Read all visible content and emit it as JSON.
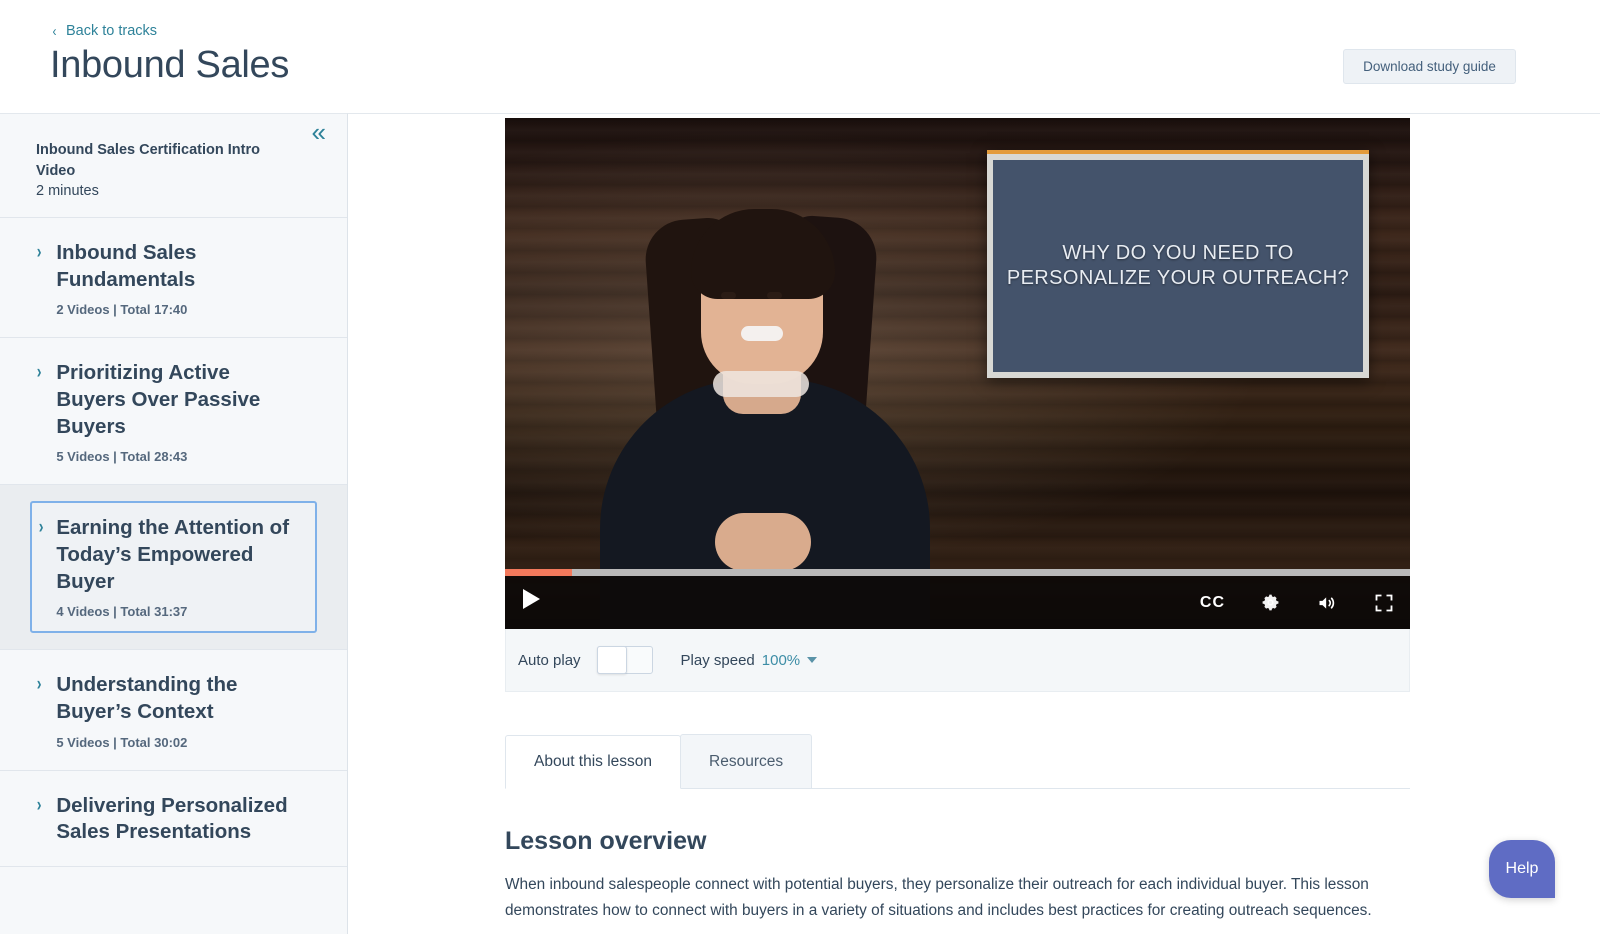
{
  "header": {
    "back_link": "Back to tracks",
    "back_icon": "chevron-left-icon",
    "title": "Inbound Sales",
    "download_button": "Download study guide"
  },
  "sidebar": {
    "collapse_icon": "«",
    "intro": {
      "title": "Inbound Sales Certification Intro Video",
      "duration": "2 minutes"
    },
    "modules": [
      {
        "chevron": "›",
        "title": "Inbound Sales Fundamentals",
        "meta": "2 Videos | Total 17:40",
        "selected": false
      },
      {
        "chevron": "›",
        "title": "Prioritizing Active Buyers Over Passive Buyers",
        "meta": "5 Videos | Total 28:43",
        "selected": false
      },
      {
        "chevron": "›",
        "title": "Earning the Attention of Today’s Empowered Buyer",
        "meta": "4 Videos | Total 31:37",
        "selected": true
      },
      {
        "chevron": "›",
        "title": "Understanding the Buyer’s Context",
        "meta": "5 Videos | Total 30:02",
        "selected": false
      },
      {
        "chevron": "›",
        "title": "Delivering Personalized Sales Presentations",
        "meta": "",
        "selected": false
      }
    ]
  },
  "video": {
    "slide_text": "WHY DO YOU NEED TO PERSONALIZE YOUR OUTREACH?",
    "progress_percent": "7.4",
    "controls": {
      "play": "play-icon",
      "cc": "CC",
      "settings": "gear-icon",
      "volume": "volume-icon",
      "fullscreen": "fullscreen-icon"
    }
  },
  "playerbar": {
    "autoplay_label": "Auto play",
    "autoplay_on": false,
    "speed_label": "Play speed",
    "speed_value": "100%",
    "speed_caret": "chevron-down-icon"
  },
  "tabs": [
    {
      "label": "About this lesson",
      "active": true
    },
    {
      "label": "Resources",
      "active": false
    }
  ],
  "lesson": {
    "heading": "Lesson overview",
    "body": "When inbound salespeople connect with potential buyers, they personalize their outreach for each individual buyer. This lesson demonstrates how to connect with buyers in a variety of situations and includes best practices for creating outreach sequences."
  },
  "help": {
    "label": "Help"
  },
  "colors": {
    "link": "#2e8299",
    "title": "#33475b",
    "sidebar_bg": "#f6f8fa",
    "selected_row_bg": "#eaedf0",
    "selected_border": "#7fb1e9",
    "progress": "#f2795c",
    "slide_bg": "#44536b",
    "slide_accent": "#e39b3c",
    "help_bg": "#5f6cc4"
  }
}
